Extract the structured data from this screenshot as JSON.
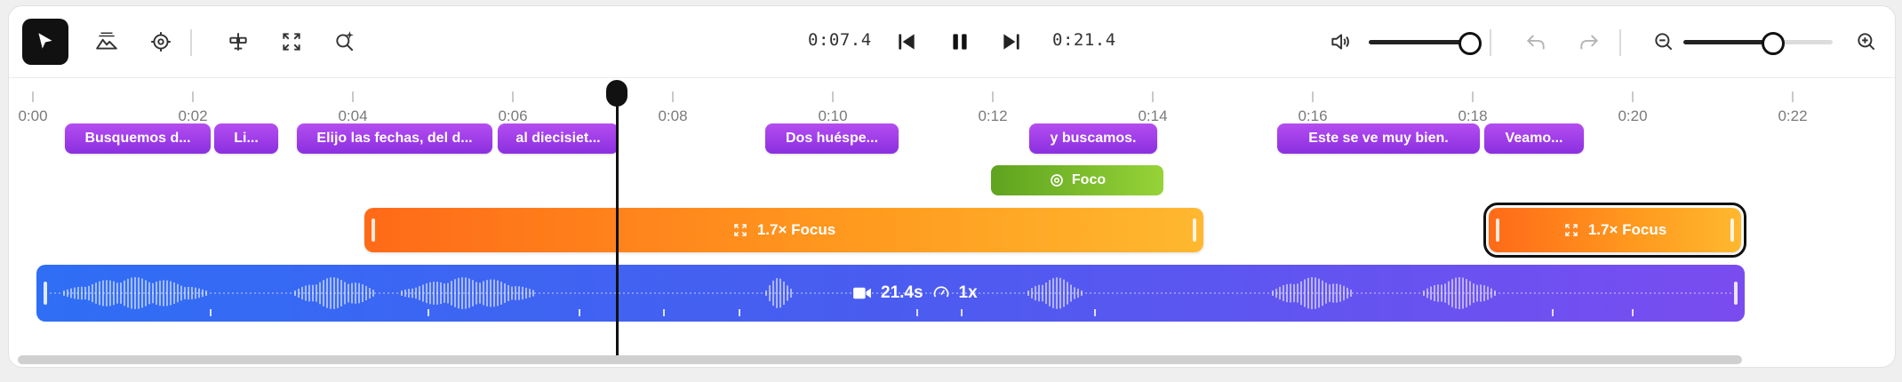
{
  "toolbar": {
    "tools": [
      {
        "name": "select-tool",
        "icon": "cursor-icon",
        "active": true
      },
      {
        "name": "background-tool",
        "icon": "mountains-icon",
        "active": false
      },
      {
        "name": "target-tool",
        "icon": "crosshair-icon",
        "active": false
      },
      {
        "name": "split-tool",
        "icon": "split-icon",
        "active": false
      },
      {
        "name": "zoom-tool",
        "icon": "expand-icon",
        "active": false
      },
      {
        "name": "magic-zoom-tool",
        "icon": "zoom-sparkle-icon",
        "active": false
      }
    ],
    "current_time": "0:07.4",
    "total_time": "0:21.4",
    "volume_level": 0.95,
    "zoom_level": 0.6
  },
  "ruler": {
    "ticks": [
      "0:00",
      "0:02",
      "0:04",
      "0:06",
      "0:08",
      "0:10",
      "0:12",
      "0:14",
      "0:16",
      "0:18",
      "0:20",
      "0:22"
    ]
  },
  "captions": [
    {
      "text": "Busquemos d..."
    },
    {
      "text": "Li..."
    },
    {
      "text": "Elijo las fechas, del d..."
    },
    {
      "text": "al diecisiet..."
    },
    {
      "text": "Dos huéspe..."
    },
    {
      "text": "y buscamos."
    },
    {
      "text": "Este se ve muy bien."
    },
    {
      "text": "Veamo..."
    }
  ],
  "focus_chip": {
    "label": "Foco",
    "icon": "target-icon",
    "color": "#7cc22a"
  },
  "zoom_segments": [
    {
      "label": "1.7× Focus",
      "icon": "expand-icon",
      "selected": false
    },
    {
      "label": "1.7× Focus",
      "icon": "expand-icon",
      "selected": true
    }
  ],
  "video_track": {
    "duration": "21.4s",
    "speed": "1x",
    "icons": [
      "camera-icon",
      "speedometer-icon"
    ]
  },
  "colors": {
    "caption": "#9b3ae6",
    "zoom": "#ff8a1f",
    "track_start": "#2f6ef5",
    "track_end": "#7a4cf0",
    "playhead": "#111111"
  }
}
